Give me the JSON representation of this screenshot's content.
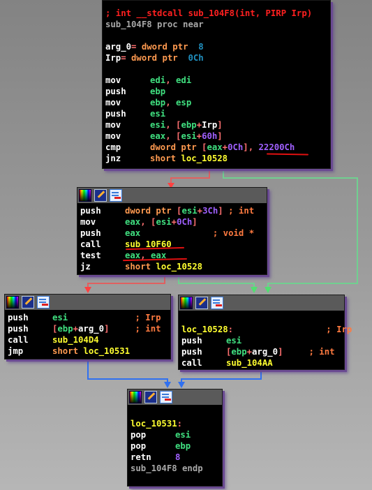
{
  "graph": {
    "edge_colors": {
      "false_branch": "#e05050",
      "true_branch": "#60d080",
      "unconditional": "#3070f0"
    },
    "nodes": [
      {
        "id": "n0",
        "has_header": false,
        "lines": [
          [
            {
              "t": "; int __stdcall sub_104F8(int, PIRP Irp)",
              "c": "red"
            }
          ],
          [
            {
              "t": "sub_104F8 proc near",
              "c": "gray"
            }
          ],
          [],
          [
            {
              "t": "arg_0",
              "c": "white"
            },
            {
              "t": "= ",
              "c": "pink"
            },
            {
              "t": "dword ptr  ",
              "c": "orange"
            },
            {
              "t": "8",
              "c": "blue"
            }
          ],
          [
            {
              "t": "Irp",
              "c": "white"
            },
            {
              "t": "= ",
              "c": "pink"
            },
            {
              "t": "dword ptr  ",
              "c": "orange"
            },
            {
              "t": "0Ch",
              "c": "blue"
            }
          ],
          [],
          [
            {
              "m": "mov"
            },
            {
              "t": "edi",
              "c": "green"
            },
            {
              "t": ", ",
              "c": "pink"
            },
            {
              "t": "edi",
              "c": "green"
            }
          ],
          [
            {
              "m": "push"
            },
            {
              "t": "ebp",
              "c": "green"
            }
          ],
          [
            {
              "m": "mov"
            },
            {
              "t": "ebp",
              "c": "green"
            },
            {
              "t": ", ",
              "c": "pink"
            },
            {
              "t": "esp",
              "c": "green"
            }
          ],
          [
            {
              "m": "push"
            },
            {
              "t": "esi",
              "c": "green"
            }
          ],
          [
            {
              "m": "mov"
            },
            {
              "t": "esi",
              "c": "green"
            },
            {
              "t": ", [",
              "c": "pink"
            },
            {
              "t": "ebp",
              "c": "green"
            },
            {
              "t": "+",
              "c": "pink"
            },
            {
              "t": "Irp",
              "c": "white"
            },
            {
              "t": "]",
              "c": "pink"
            }
          ],
          [
            {
              "m": "mov"
            },
            {
              "t": "eax",
              "c": "green"
            },
            {
              "t": ", [",
              "c": "pink"
            },
            {
              "t": "esi",
              "c": "green"
            },
            {
              "t": "+",
              "c": "pink"
            },
            {
              "t": "60h",
              "c": "purple"
            },
            {
              "t": "]",
              "c": "pink"
            }
          ],
          [
            {
              "m": "cmp"
            },
            {
              "t": "dword ptr ",
              "c": "orange"
            },
            {
              "t": "[",
              "c": "pink"
            },
            {
              "t": "eax",
              "c": "green"
            },
            {
              "t": "+",
              "c": "pink"
            },
            {
              "t": "0Ch",
              "c": "purple"
            },
            {
              "t": "], ",
              "c": "pink"
            },
            {
              "t": "22200Ch",
              "c": "purple"
            }
          ],
          [
            {
              "m": "jnz"
            },
            {
              "t": "short ",
              "c": "orange"
            },
            {
              "t": "loc_10528",
              "c": "yellow"
            }
          ]
        ]
      },
      {
        "id": "n1",
        "has_header": true,
        "lines": [
          [
            {
              "m": "push"
            },
            {
              "t": "dword ptr ",
              "c": "orange"
            },
            {
              "t": "[",
              "c": "pink"
            },
            {
              "t": "esi",
              "c": "green"
            },
            {
              "t": "+",
              "c": "pink"
            },
            {
              "t": "3Ch",
              "c": "purple"
            },
            {
              "t": "] ",
              "c": "pink"
            },
            {
              "t": "; int",
              "c": "cmt"
            }
          ],
          [
            {
              "m": "mov"
            },
            {
              "t": "eax",
              "c": "green"
            },
            {
              "t": ", [",
              "c": "pink"
            },
            {
              "t": "esi",
              "c": "green"
            },
            {
              "t": "+",
              "c": "pink"
            },
            {
              "t": "0Ch",
              "c": "purple"
            },
            {
              "t": "]",
              "c": "pink"
            }
          ],
          [
            {
              "m": "push"
            },
            {
              "t": "eax",
              "c": "green"
            },
            {
              "t": "              ; void *",
              "c": "cmt"
            }
          ],
          [
            {
              "m": "call"
            },
            {
              "t": "sub_10F60",
              "c": "yellow"
            }
          ],
          [
            {
              "m": "test"
            },
            {
              "t": "eax",
              "c": "green"
            },
            {
              "t": ", ",
              "c": "pink"
            },
            {
              "t": "eax",
              "c": "green"
            }
          ],
          [
            {
              "m": "jz"
            },
            {
              "t": "short ",
              "c": "orange"
            },
            {
              "t": "loc_10528",
              "c": "yellow"
            }
          ]
        ]
      },
      {
        "id": "n2",
        "has_header": true,
        "lines": [
          [
            {
              "m": "push"
            },
            {
              "t": "esi",
              "c": "green"
            },
            {
              "t": "             ; Irp",
              "c": "cmt"
            }
          ],
          [
            {
              "m": "push"
            },
            {
              "t": "[",
              "c": "pink"
            },
            {
              "t": "ebp",
              "c": "green"
            },
            {
              "t": "+",
              "c": "pink"
            },
            {
              "t": "arg_0",
              "c": "white"
            },
            {
              "t": "]",
              "c": "pink"
            },
            {
              "t": "     ; int",
              "c": "cmt"
            }
          ],
          [
            {
              "m": "call"
            },
            {
              "t": "sub_104D4",
              "c": "yellow"
            }
          ],
          [
            {
              "m": "jmp"
            },
            {
              "t": "short ",
              "c": "orange"
            },
            {
              "t": "loc_10531",
              "c": "yellow"
            }
          ]
        ]
      },
      {
        "id": "n3",
        "has_header": true,
        "lines": [
          [],
          [
            {
              "t": "loc_10528",
              "c": "yellow"
            },
            {
              "t": ":",
              "c": "pink"
            },
            {
              "t": "                  ; Irp",
              "c": "cmt"
            }
          ],
          [
            {
              "m": "push"
            },
            {
              "t": "esi",
              "c": "green"
            }
          ],
          [
            {
              "m": "push"
            },
            {
              "t": "[",
              "c": "pink"
            },
            {
              "t": "ebp",
              "c": "green"
            },
            {
              "t": "+",
              "c": "pink"
            },
            {
              "t": "arg_0",
              "c": "white"
            },
            {
              "t": "]",
              "c": "pink"
            },
            {
              "t": "     ; int",
              "c": "cmt"
            }
          ],
          [
            {
              "m": "call"
            },
            {
              "t": "sub_104AA",
              "c": "yellow"
            }
          ]
        ]
      },
      {
        "id": "n4",
        "has_header": true,
        "lines": [
          [],
          [
            {
              "t": "loc_10531",
              "c": "yellow"
            },
            {
              "t": ":",
              "c": "pink"
            }
          ],
          [
            {
              "m": "pop"
            },
            {
              "t": "esi",
              "c": "green"
            }
          ],
          [
            {
              "m": "pop"
            },
            {
              "t": "ebp",
              "c": "green"
            }
          ],
          [
            {
              "m": "retn"
            },
            {
              "t": "8",
              "c": "purple"
            }
          ],
          [
            {
              "t": "sub_104F8 endp",
              "c": "gray"
            }
          ],
          []
        ]
      }
    ],
    "edges": [
      {
        "from": "n0",
        "to": "n1",
        "kind": "false_branch"
      },
      {
        "from": "n0",
        "to": "n3",
        "kind": "true_branch"
      },
      {
        "from": "n1",
        "to": "n2",
        "kind": "false_branch"
      },
      {
        "from": "n1",
        "to": "n3",
        "kind": "true_branch"
      },
      {
        "from": "n2",
        "to": "n4",
        "kind": "unconditional"
      },
      {
        "from": "n3",
        "to": "n4",
        "kind": "unconditional"
      }
    ],
    "annotations": [
      {
        "node": "n0",
        "text": "22200Ch",
        "style": "red-underline"
      },
      {
        "node": "n1",
        "text": "sub_10F60",
        "style": "red-underline"
      },
      {
        "node": "n1",
        "text": "eax, eax",
        "style": "red-underline"
      }
    ]
  },
  "header_icons": [
    "color-palette-icon",
    "edit-pencil-icon",
    "graph-view-icon"
  ]
}
